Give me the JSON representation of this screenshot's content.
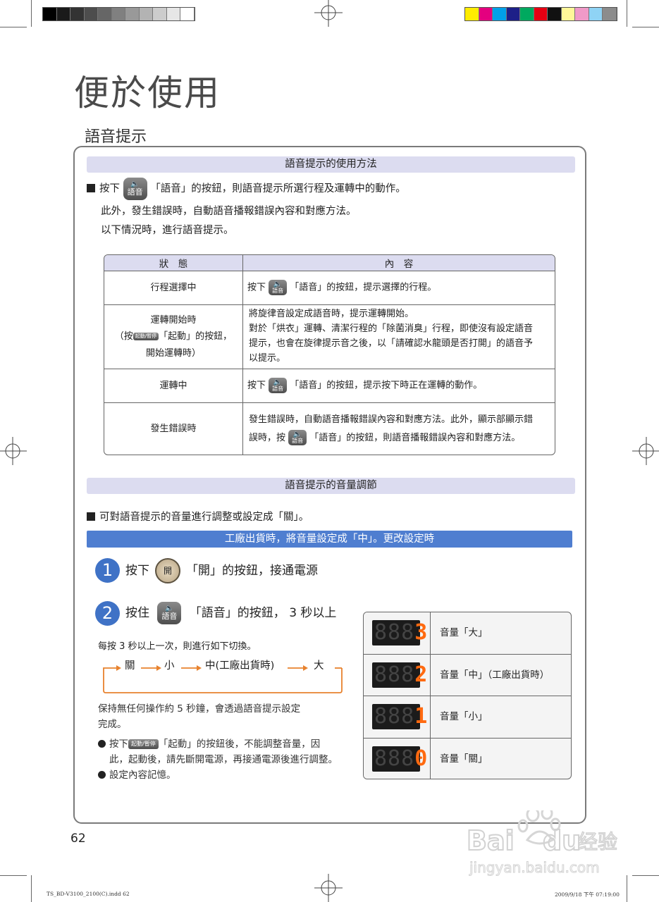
{
  "page": {
    "title": "便於使用",
    "section_title": "語音提示",
    "page_number": "62"
  },
  "usage": {
    "bar_title": "語音提示的使用方法",
    "btn_label": "語音",
    "intro_pre": "按下",
    "intro_post": "「語音」的按鈕，則語音提示所選行程及運轉中的動作。",
    "line2": "此外，發生錯誤時，自動語音播報錯誤內容和對應方法。",
    "line3": "以下情況時，進行語音提示。"
  },
  "state_table": {
    "col1_header": "狀　態",
    "col2_header": "內　容",
    "rows": [
      {
        "state": "行程選擇中",
        "pre": "按下",
        "btn": "語音",
        "post": "「語音」的按鈕，提示選擇的行程。"
      },
      {
        "state_l1": "運轉開始時",
        "state_pre": "（按",
        "state_btn": "起動/暫停",
        "state_post": "「起動」的按鈕，",
        "state_l3": "開始運轉時）",
        "content": "將旋律音設定成語音時，提示運轉開始。\n對於「烘衣」運轉、清潔行程的「除菌消臭」行程，即使沒有設定語音\n提示，也會在旋律提示音之後，以「請確認水龍頭是否打開」的語音予\n以提示。"
      },
      {
        "state": "運轉中",
        "pre": "按下",
        "btn": "語音",
        "post": "「語音」的按鈕，提示按下時正在運轉的動作。"
      },
      {
        "state": "發生錯誤時",
        "l1": "發生錯誤時，自動語音播報錯誤內容和對應方法。此外，顯示部顯示錯",
        "pre": "誤時，按",
        "btn": "語音",
        "post": "「語音」的按鈕，則語音播報錯誤內容和對應方法。"
      }
    ]
  },
  "volume": {
    "bar_title": "語音提示的音量調節",
    "intro": "可對語音提示的音量進行調整或設定成「關」。",
    "blue_bar": "工廠出貨時，將音量設定成「中」。更改設定時",
    "step1": {
      "num": "1",
      "pre": "按下",
      "btn": "開",
      "post": "「開」的按鈕，接通電源"
    },
    "step2": {
      "num": "2",
      "pre": "按住",
      "btn": "語音",
      "post": "「語音」的按鈕，  3 秒以上"
    },
    "each_press": "每按 3 秒以上一次，則進行如下切換。",
    "flow": [
      "關",
      "小",
      "中(工廠出貨時)",
      "大"
    ],
    "hold_note": "保持無任何操作約 5 秒鐘，會透過語音提示設定\n完成。",
    "bullet1_pre": "按下",
    "bullet1_btn": "起動/暫停",
    "bullet1_post": "「起動」的按鈕後，不能調整音量，因",
    "bullet1_l2": "此，起動後，請先斷開電源，再接通電源後進行調整。",
    "bullet2": "設定內容記憶。",
    "levels": [
      {
        "digits_dim": "888",
        "digit_lit": "3",
        "label": "音量「大」"
      },
      {
        "digits_dim": "888",
        "digit_lit": "2",
        "label": "音量「中」（工廠出貨時）"
      },
      {
        "digits_dim": "888",
        "digit_lit": "1",
        "label": "音量「小」"
      },
      {
        "digits_dim": "888",
        "digit_lit": "0",
        "label": "音量「關」"
      }
    ]
  },
  "footer": {
    "slug_left": "TS_BD-V3100_2100(C).indd   62",
    "slug_right": "2009/9/18   下午 07:19:00"
  },
  "colors": {
    "bar_bg": "#dcdcf0",
    "blue_bar": "#4f7ed0",
    "step_circle": "#3f72c6",
    "flow_arrow": "#e8822e",
    "lcd_lit": "#ff6a10"
  },
  "icons": [
    "speaker-icon",
    "registration-mark-icon",
    "arrow-right-icon",
    "bullet-icon",
    "baidu-paw-icon"
  ]
}
